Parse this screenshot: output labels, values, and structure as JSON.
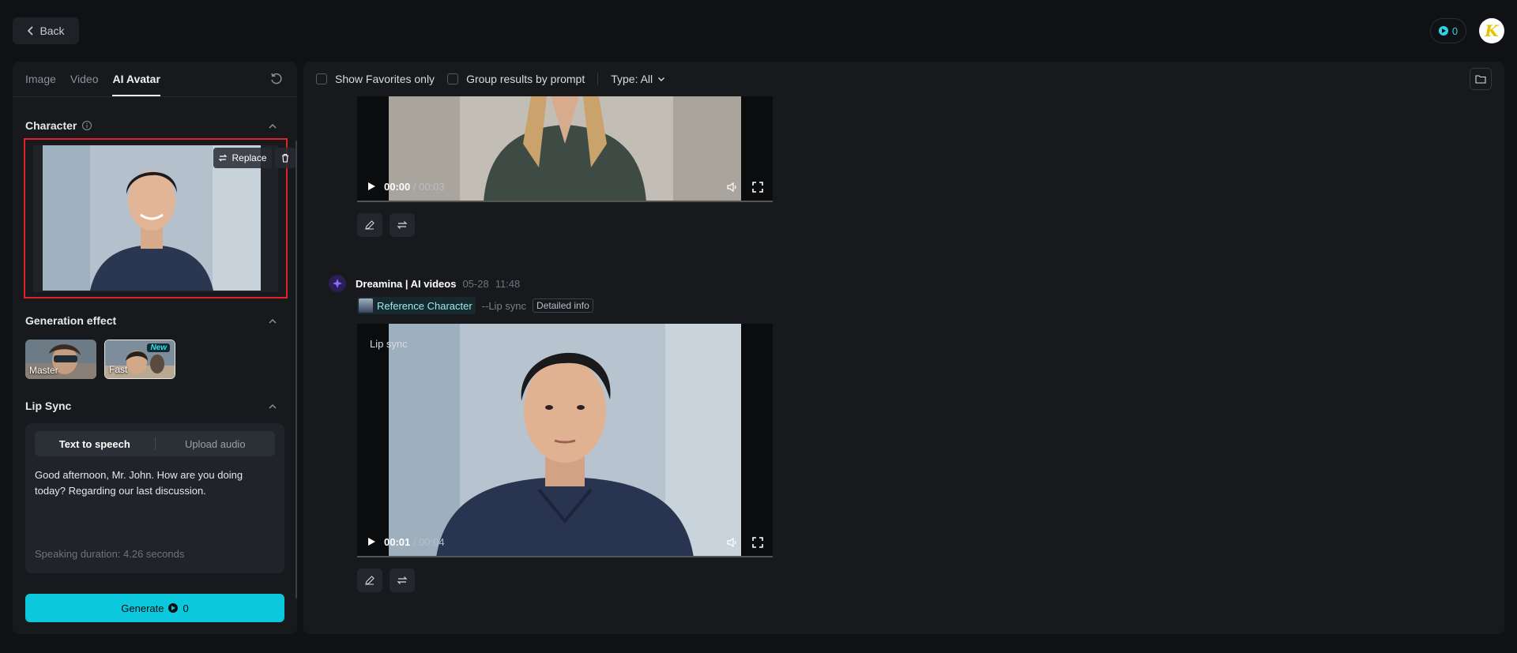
{
  "topbar": {
    "back_label": "Back",
    "credits": "0",
    "avatar_letter": "K"
  },
  "left_panel": {
    "tabs": [
      {
        "label": "Image",
        "active": false
      },
      {
        "label": "Video",
        "active": false
      },
      {
        "label": "AI Avatar",
        "active": true
      }
    ],
    "character": {
      "title": "Character",
      "replace_label": "Replace"
    },
    "generation_effect": {
      "title": "Generation effect",
      "options": [
        {
          "label": "Master",
          "selected": false
        },
        {
          "label": "Fast",
          "selected": true,
          "badge": "New"
        }
      ]
    },
    "lip_sync": {
      "title": "Lip Sync",
      "modes": [
        "Text to speech",
        "Upload audio"
      ],
      "active_mode": "Text to speech",
      "text": "Good afternoon, Mr. John. How are you doing today? Regarding our last discussion.",
      "duration": "Speaking duration: 4.26 seconds"
    },
    "generate": {
      "label": "Generate",
      "cost": "0"
    }
  },
  "main": {
    "filters": {
      "favorites_label": "Show Favorites only",
      "group_label": "Group results by prompt",
      "type_label": "Type: All"
    },
    "video1": {
      "current_time": "00:00",
      "total_time": "/ 00:03"
    },
    "generation": {
      "name": "Dreamina | AI videos",
      "date": "05-28",
      "time": "11:48",
      "ref_label": "Reference Character",
      "mode": "--Lip sync",
      "detail_label": "Detailed info"
    },
    "video2": {
      "overlay_label": "Lip sync",
      "current_time": "00:01",
      "total_time": "/ 00:04"
    }
  },
  "colors": {
    "accent": "#0cc8dd",
    "highlight_border": "#e3212b",
    "background": "#0f1114",
    "panel": "#17191d"
  }
}
